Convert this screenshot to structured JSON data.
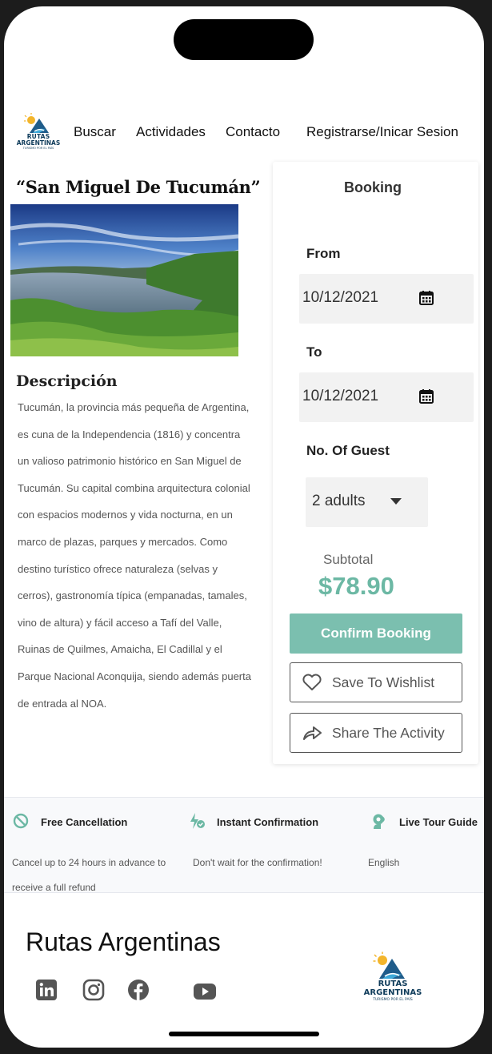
{
  "header": {
    "logo": {
      "line1": "RUTAS",
      "line2": "ARGENTINAS",
      "tagline": "TURISMO POR EL PAÍS"
    },
    "nav": [
      "Buscar",
      "Actividades",
      "Contacto",
      "Registrarse/Inicar Sesion"
    ]
  },
  "place": {
    "title": "“San Miguel De Tucumán”",
    "image_icon": "landscape-photo-lake-mountains",
    "description_title": "Descripción",
    "description": "Tucumán, la provincia más pequeña de Argentina, es cuna de la Independencia (1816) y concentra un valioso patrimonio histórico en San Miguel de Tucumán. Su capital combina arquitectura colonial con espacios modernos y vida nocturna, en un marco de plazas, parques y mercados. Como destino turístico ofrece naturaleza (selvas y cerros), gastronomía típica (empanadas, tamales, vino de altura) y fácil acceso a Tafí del Valle, Ruinas de Quilmes, Amaicha, El Cadillal y el Parque Nacional Aconquija, siendo además puerta de entrada al NOA."
  },
  "booking": {
    "title": "Booking",
    "from_label": "From",
    "from_value": "10/12/2021",
    "to_label": "To",
    "to_value": "10/12/2021",
    "guests_label": "No. Of Guest",
    "guests_value": "2 adults",
    "subtotal_label": "Subtotal",
    "subtotal_value": "$78.90",
    "confirm_label": "Confirm Booking",
    "wishlist_label": "Save To Wishlist",
    "share_label": "Share The Activity",
    "accent_color": "#7bbfaf"
  },
  "features": [
    {
      "icon": "no-sign-icon",
      "title": "Free Cancellation",
      "desc": "Cancel up to 24 hours in advance to receive a full refund"
    },
    {
      "icon": "instant-confirm-icon",
      "title": "Instant Confirmation",
      "desc": "Don't wait for the confirmation!"
    },
    {
      "icon": "guide-icon",
      "title": "Live Tour Guide",
      "desc": "English"
    }
  ],
  "footer": {
    "brand": "Rutas Argentinas",
    "social": [
      "linkedin-icon",
      "instagram-icon",
      "facebook-icon",
      "youtube-icon"
    ],
    "logo": {
      "line1": "RUTAS",
      "line2": "ARGENTINAS",
      "tagline": "TURISMO POR EL PAÍS"
    }
  }
}
